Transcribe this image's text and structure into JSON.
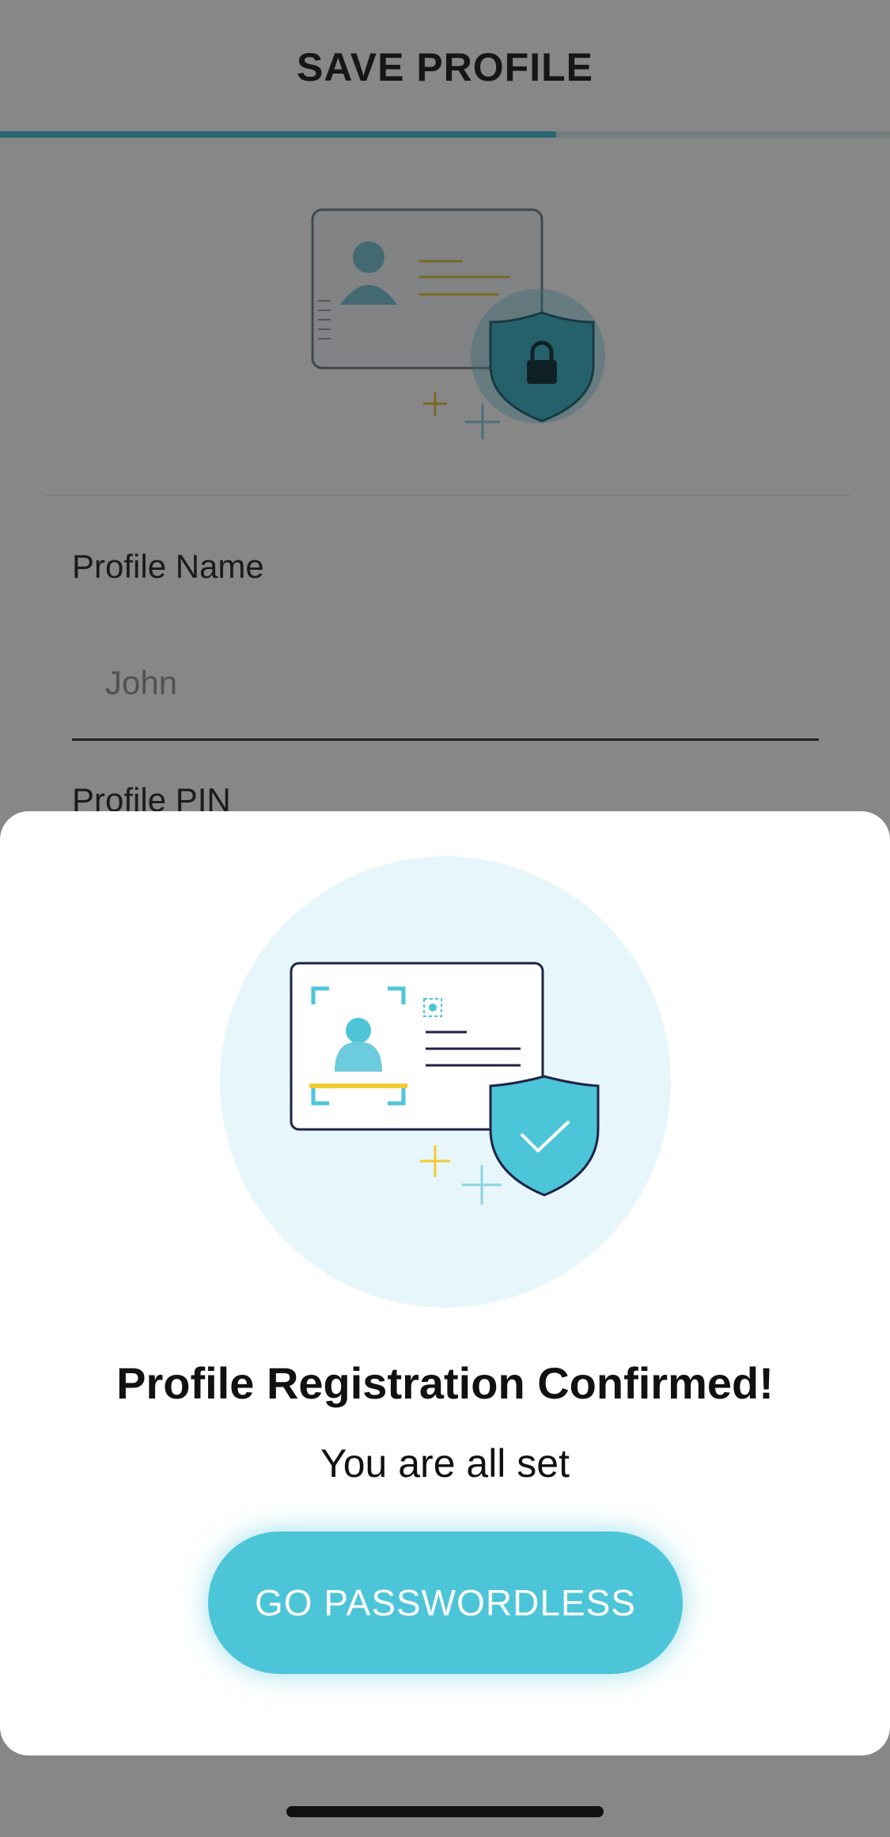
{
  "header": {
    "title": "SAVE PROFILE",
    "progress": 0.625
  },
  "form": {
    "name_label": "Profile Name",
    "name_value": "John",
    "pin_label": "Profile PIN"
  },
  "modal": {
    "title": "Profile Registration Confirmed!",
    "subtitle": "You are all set",
    "button_label": "GO PASSWORDLESS",
    "illustration_icon": "id-card-shield-check-icon"
  },
  "background_illustration_icon": "id-card-shield-lock-icon",
  "colors": {
    "accent": "#4cc5d8",
    "accent_light": "#e6f6fa",
    "highlight_yellow": "#f2cb32",
    "card_outline": "#1f2347",
    "overlay": "rgba(0,0,0,0.47)"
  }
}
